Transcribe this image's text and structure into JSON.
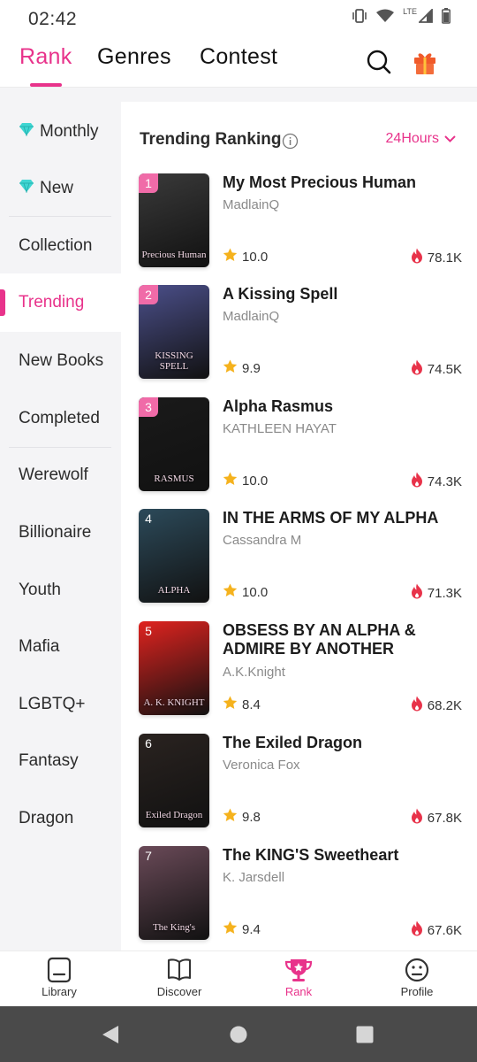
{
  "status": {
    "time": "02:42",
    "network": "LTE"
  },
  "top_tabs": [
    {
      "label": "Rank",
      "active": true
    },
    {
      "label": "Genres",
      "active": false
    },
    {
      "label": "Contest",
      "active": false
    }
  ],
  "sidebar": {
    "items": [
      {
        "label": "Monthly",
        "icon": "diamond-icon"
      },
      {
        "label": "New",
        "icon": "diamond-icon"
      },
      {
        "label": "Collection"
      },
      {
        "label": "Trending",
        "active": true
      },
      {
        "label": "New Books"
      },
      {
        "label": "Completed"
      },
      {
        "label": "Werewolf"
      },
      {
        "label": "Billionaire"
      },
      {
        "label": "Youth"
      },
      {
        "label": "Mafia"
      },
      {
        "label": "LGBTQ+"
      },
      {
        "label": "Fantasy"
      },
      {
        "label": "Dragon"
      }
    ]
  },
  "ranking": {
    "title": "Trending Ranking",
    "period": "24Hours",
    "books": [
      {
        "rank": "1",
        "title": "My Most Precious Human",
        "author": "MadlainQ",
        "rating": "10.0",
        "reads": "78.1K",
        "cover_color": "#3a3a3a",
        "cover_text": "Precious Human"
      },
      {
        "rank": "2",
        "title": "A Kissing Spell",
        "author": "MadlainQ",
        "rating": "9.9",
        "reads": "74.5K",
        "cover_color": "#4b4f8a",
        "cover_text": "KISSING SPELL"
      },
      {
        "rank": "3",
        "title": "Alpha Rasmus",
        "author": "KATHLEEN HAYAT",
        "rating": "10.0",
        "reads": "74.3K",
        "cover_color": "#1a1a1a",
        "cover_text": "RASMUS"
      },
      {
        "rank": "4",
        "title": "IN THE ARMS OF MY ALPHA",
        "author": "Cassandra M",
        "rating": "10.0",
        "reads": "71.3K",
        "cover_color": "#2c4a5a",
        "cover_text": "ALPHA"
      },
      {
        "rank": "5",
        "title": "OBSESS BY AN ALPHA & ADMIRE BY ANOTHER",
        "author": "A.K.Knight",
        "rating": "8.4",
        "reads": "68.2K",
        "cover_color": "#e0231f",
        "cover_text": "A. K. KNIGHT"
      },
      {
        "rank": "6",
        "title": "The Exiled Dragon",
        "author": "Veronica Fox",
        "rating": "9.8",
        "reads": "67.8K",
        "cover_color": "#2a2320",
        "cover_text": "Exiled Dragon"
      },
      {
        "rank": "7",
        "title": "The KING'S Sweetheart",
        "author": "K. Jarsdell",
        "rating": "9.4",
        "reads": "67.6K",
        "cover_color": "#6a4a58",
        "cover_text": "The King's"
      }
    ]
  },
  "bottom_nav": [
    {
      "label": "Library",
      "icon": "book-icon"
    },
    {
      "label": "Discover",
      "icon": "open-book-icon"
    },
    {
      "label": "Rank",
      "icon": "trophy-icon",
      "active": true
    },
    {
      "label": "Profile",
      "icon": "face-icon"
    }
  ],
  "colors": {
    "accent": "#e8338b",
    "badge": "#f06ba8",
    "star": "#f5b21d",
    "flame": "#e8334a"
  }
}
